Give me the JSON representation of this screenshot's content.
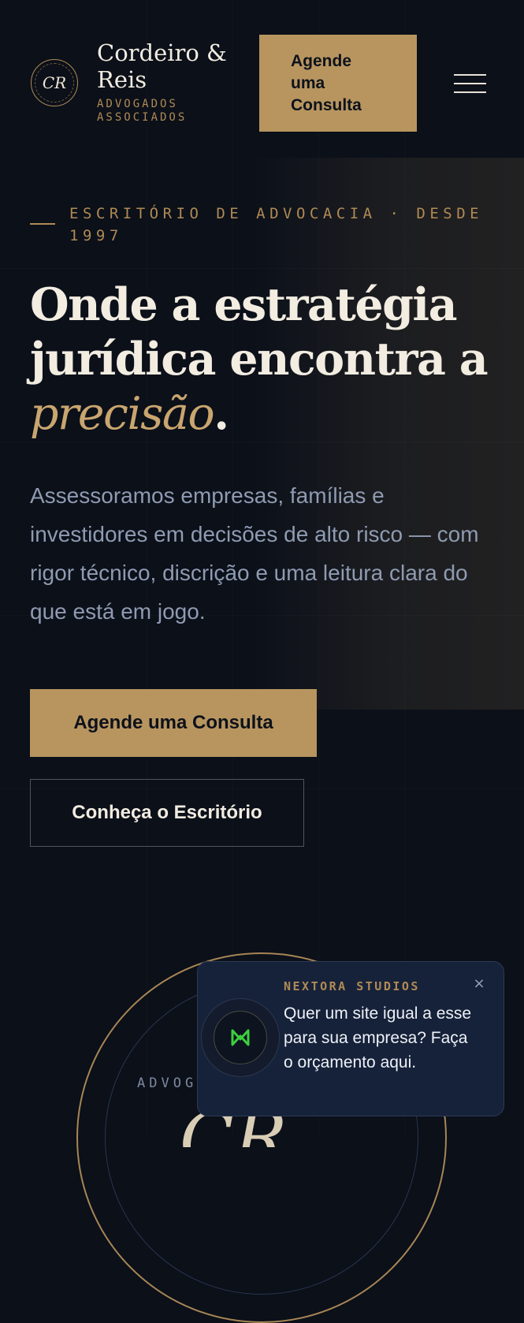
{
  "brand": {
    "monogram": "CR",
    "name": "Cordeiro & Reis",
    "subtitle": "ADVOGADOS ASSOCIADOS",
    "accent_color": "#b8955f"
  },
  "header": {
    "cta_label": "Agende uma Consulta",
    "menu_icon": "hamburger-icon"
  },
  "hero": {
    "eyebrow": "ESCRITÓRIO DE ADVOCACIA · DESDE 1997",
    "headline_main": "Onde a estratégia jurídica encontra a ",
    "headline_accent": "precisão",
    "headline_end": ".",
    "lede": "Assessoramos empresas, famílias e investidores em decisões de alto risco — com rigor técnico, discrição e uma leitura clara do que está em jogo.",
    "primary_cta": "Agende uma Consulta",
    "secondary_cta": "Conheça o Escritório"
  },
  "emblem": {
    "arc_text": "ADVOG",
    "monogram": "CR"
  },
  "promo": {
    "brand": "NEXTORA STUDIOS",
    "text": "Quer um site igual a esse para sua empresa? Faça o orçamento aqui.",
    "close_label": "×",
    "logo_icon": "nextora-logo-icon",
    "logo_color": "#3ccf3c"
  }
}
